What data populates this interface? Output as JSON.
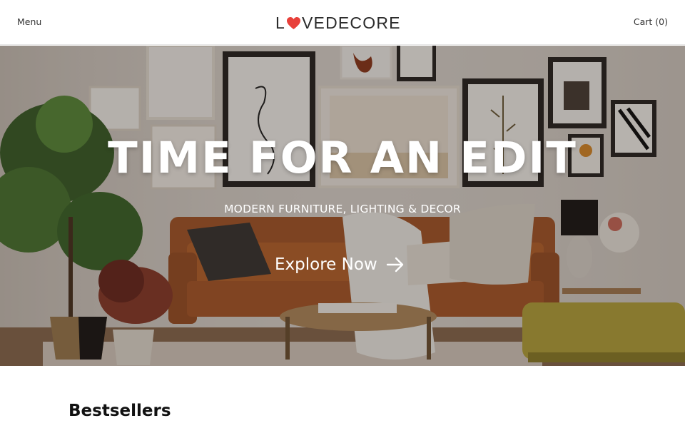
{
  "header": {
    "menu_label": "Menu",
    "logo": {
      "first": "L",
      "rest": "VEDECORE",
      "accent": "#e8403a"
    },
    "cart_label": "Cart (0)"
  },
  "hero": {
    "title": "TIME FOR AN EDIT",
    "subtitle": "MODERN FURNITURE, LIGHTING & DECOR",
    "cta_label": "Explore Now",
    "cta_icon": "arrow-right-icon"
  },
  "sections": {
    "bestsellers_title": "Bestsellers"
  }
}
